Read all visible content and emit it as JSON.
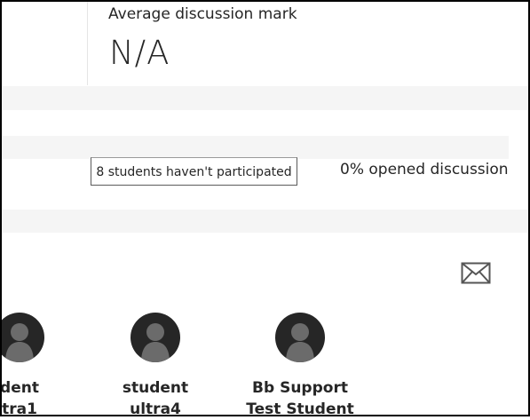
{
  "summary": {
    "average_label": "Average discussion mark",
    "average_value": "N/A"
  },
  "participation": {
    "not_participated_label": "8 students haven't participated",
    "opened_label": "0% opened discussion"
  },
  "icons": {
    "message": "envelope-icon",
    "avatar": "user-silhouette-icon"
  },
  "students": [
    {
      "name_line1": "dent",
      "name_line2": "tra1"
    },
    {
      "name_line1": "student",
      "name_line2": "ultra4"
    },
    {
      "name_line1": "Bb Support",
      "name_line2": "Test Student"
    }
  ]
}
